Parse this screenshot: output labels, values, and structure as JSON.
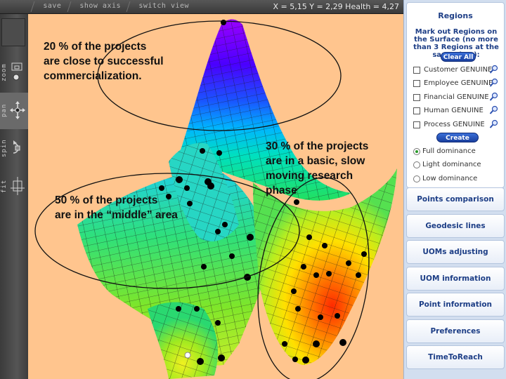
{
  "toolbar": {
    "save_label": "save",
    "show_axis_label": "show axis",
    "switch_view_label": "switch view",
    "status": "X = 5,15  Y = 2,29  Health = 4,27"
  },
  "rail": {
    "tools": [
      {
        "label": "zoom"
      },
      {
        "label": "pan"
      },
      {
        "label": "spin"
      },
      {
        "label": "fit"
      }
    ]
  },
  "annotations": {
    "top": "20 % of the projects\nare close to successful\ncommercialization.",
    "middle": "50 % of the projects\nare in the “middle” area",
    "right": "30 % of the projects\nare in a basic, slow\nmoving research\nphase"
  },
  "regions": {
    "title": "Regions",
    "description": "Mark out Regions on the Surface (no more than 3 Regions at the same time):",
    "clear_all": "Clear All",
    "create_new": "Create New",
    "checkboxes": [
      {
        "label": "Customer GENUINE",
        "checked": false
      },
      {
        "label": "Employee GENUINE",
        "checked": false
      },
      {
        "label": "Financial GENUINE",
        "checked": false
      },
      {
        "label": "Human GENUINE",
        "checked": false
      },
      {
        "label": "Process GENUINE",
        "checked": false
      }
    ],
    "dominance": [
      {
        "label": "Full dominance",
        "selected": true
      },
      {
        "label": "Light dominance",
        "selected": false
      },
      {
        "label": "Low dominance",
        "selected": false
      }
    ]
  },
  "nav_buttons": [
    "Points comparison",
    "Geodesic lines",
    "UOMs adjusting",
    "UOM information",
    "Point information",
    "Preferences",
    "TimeToReach"
  ],
  "colors": {
    "background": "#ffc58e",
    "panel": "#d2deef",
    "accent": "#1d3e86",
    "point": "#000000"
  }
}
